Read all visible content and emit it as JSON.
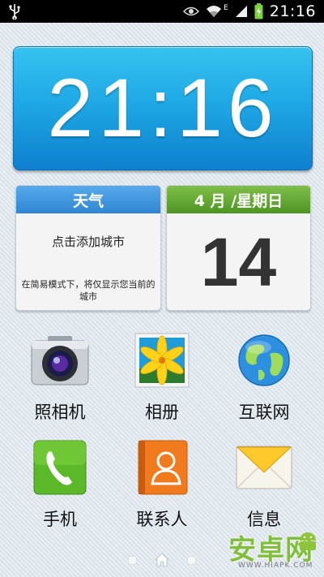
{
  "status_bar": {
    "time": "21:16",
    "network_type": "E",
    "icons": [
      "usb-icon",
      "eye-icon",
      "wifi-icon",
      "signal-icon",
      "battery-charging-icon"
    ]
  },
  "clock_widget": {
    "time": "21:16"
  },
  "weather_widget": {
    "title": "天气",
    "add_city": "点击添加城市",
    "note": "在简易模式下，将仅显示您当前的城市"
  },
  "calendar_widget": {
    "header": "4 月 /星期日",
    "day": "14"
  },
  "apps": [
    {
      "label": "照相机",
      "icon": "camera-icon"
    },
    {
      "label": "相册",
      "icon": "gallery-icon"
    },
    {
      "label": "互联网",
      "icon": "globe-icon"
    },
    {
      "label": "手机",
      "icon": "phone-icon"
    },
    {
      "label": "联系人",
      "icon": "contacts-icon"
    },
    {
      "label": "信息",
      "icon": "message-icon"
    }
  ],
  "page_indicator": {
    "current": "home"
  },
  "watermark": {
    "text": "安卓网",
    "url": "WWW.HIAPK.COM"
  },
  "colors": {
    "clock_bg": "#1fa9e6",
    "weather_header": "#3a8fd8",
    "calendar_header": "#5fa330"
  }
}
